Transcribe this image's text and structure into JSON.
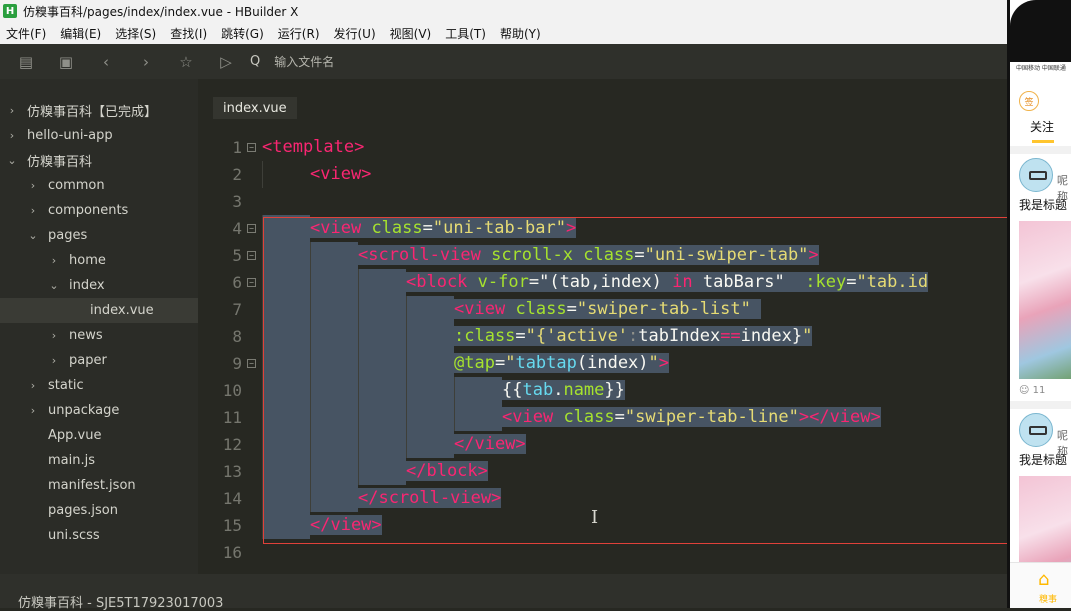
{
  "window": {
    "app_icon": "H",
    "title": "仿糗事百科/pages/index/index.vue - HBuilder X"
  },
  "menu": [
    "文件(F)",
    "编辑(E)",
    "选择(S)",
    "查找(I)",
    "跳转(G)",
    "运行(R)",
    "发行(U)",
    "视图(V)",
    "工具(T)",
    "帮助(Y)"
  ],
  "toolbar": {
    "icons": [
      "new-file-icon",
      "save-icon",
      "back-icon",
      "forward-icon",
      "star-icon",
      "run-icon"
    ],
    "search_prefix": "Q",
    "search_placeholder": "输入文件名"
  },
  "sidebar": {
    "items": [
      {
        "label": "仿糗事百科【已完成】",
        "arrow": "›",
        "depth": 0
      },
      {
        "label": "hello-uni-app",
        "arrow": "›",
        "depth": 0
      },
      {
        "label": "仿糗事百科",
        "arrow": "⌄",
        "depth": 0
      },
      {
        "label": "common",
        "arrow": "›",
        "depth": 1
      },
      {
        "label": "components",
        "arrow": "›",
        "depth": 1
      },
      {
        "label": "pages",
        "arrow": "⌄",
        "depth": 1
      },
      {
        "label": "home",
        "arrow": "›",
        "depth": 2
      },
      {
        "label": "index",
        "arrow": "⌄",
        "depth": 2
      },
      {
        "label": "index.vue",
        "arrow": "",
        "depth": 3,
        "selected": true
      },
      {
        "label": "news",
        "arrow": "›",
        "depth": 2
      },
      {
        "label": "paper",
        "arrow": "›",
        "depth": 2
      },
      {
        "label": "static",
        "arrow": "›",
        "depth": 1
      },
      {
        "label": "unpackage",
        "arrow": "›",
        "depth": 1
      },
      {
        "label": "App.vue",
        "arrow": "",
        "depth": 1
      },
      {
        "label": "main.js",
        "arrow": "",
        "depth": 1
      },
      {
        "label": "manifest.json",
        "arrow": "",
        "depth": 1
      },
      {
        "label": "pages.json",
        "arrow": "",
        "depth": 1
      },
      {
        "label": "uni.scss",
        "arrow": "",
        "depth": 1
      }
    ]
  },
  "editor": {
    "tab": "index.vue",
    "lines": [
      {
        "n": "1",
        "fold": true,
        "indent": 0,
        "hl": false,
        "parts": [
          [
            "tag",
            "<template>"
          ]
        ]
      },
      {
        "n": "2",
        "fold": false,
        "indent": 1,
        "hl": false,
        "parts": [
          [
            "tag",
            "<view>"
          ]
        ]
      },
      {
        "n": "3",
        "fold": false,
        "indent": 0,
        "hl": false,
        "parts": []
      },
      {
        "n": "4",
        "fold": true,
        "indent": 1,
        "hl": true,
        "parts": [
          [
            "tag",
            "<view"
          ],
          [
            "plain",
            " "
          ],
          [
            "attr",
            "class"
          ],
          [
            "plain",
            "="
          ],
          [
            "str",
            "\"uni-tab-bar\""
          ],
          [
            "tag",
            ">"
          ]
        ]
      },
      {
        "n": "5",
        "fold": true,
        "indent": 2,
        "hl": true,
        "parts": [
          [
            "tag",
            "<scroll-view"
          ],
          [
            "plain",
            " "
          ],
          [
            "attr",
            "scroll-x"
          ],
          [
            "plain",
            " "
          ],
          [
            "attr",
            "class"
          ],
          [
            "plain",
            "="
          ],
          [
            "str",
            "\"uni-swiper-tab\""
          ],
          [
            "tag",
            ">"
          ]
        ]
      },
      {
        "n": "6",
        "fold": true,
        "indent": 3,
        "hl": true,
        "parts": [
          [
            "tag",
            "<block"
          ],
          [
            "plain",
            " "
          ],
          [
            "attr",
            "v-for"
          ],
          [
            "plain",
            "=\"(tab,index) "
          ],
          [
            "kw",
            "in"
          ],
          [
            "plain",
            " tabBars\"  "
          ],
          [
            "attr",
            ":key"
          ],
          [
            "plain",
            "="
          ],
          [
            "str",
            "\"tab.id"
          ]
        ]
      },
      {
        "n": "7",
        "fold": false,
        "indent": 4,
        "hl": true,
        "parts": [
          [
            "tag",
            "<view"
          ],
          [
            "plain",
            " "
          ],
          [
            "attr",
            "class"
          ],
          [
            "plain",
            "="
          ],
          [
            "str",
            "\"swiper-tab-list\""
          ],
          [
            "dim",
            " "
          ]
        ]
      },
      {
        "n": "8",
        "fold": false,
        "indent": 4,
        "hl": true,
        "parts": [
          [
            "attr",
            ":class"
          ],
          [
            "plain",
            "="
          ],
          [
            "str",
            "\"{"
          ],
          [
            "str",
            "'active'"
          ],
          [
            "dim",
            ":"
          ],
          [
            "plain",
            "tabIndex"
          ],
          [
            "kw",
            "=="
          ],
          [
            "plain",
            "index}"
          ],
          [
            "str",
            "\""
          ]
        ]
      },
      {
        "n": "9",
        "fold": true,
        "indent": 4,
        "hl": true,
        "parts": [
          [
            "attr",
            "@tap"
          ],
          [
            "plain",
            "="
          ],
          [
            "str",
            "\""
          ],
          [
            "fn",
            "tabtap"
          ],
          [
            "plain",
            "(index)"
          ],
          [
            "str",
            "\""
          ],
          [
            "tag",
            ">"
          ]
        ]
      },
      {
        "n": "10",
        "fold": false,
        "indent": 5,
        "hl": true,
        "parts": [
          [
            "plain",
            "{{"
          ],
          [
            "fn",
            "tab"
          ],
          [
            "plain",
            "."
          ],
          [
            "attr",
            "name"
          ],
          [
            "plain",
            "}}"
          ]
        ]
      },
      {
        "n": "11",
        "fold": false,
        "indent": 5,
        "hl": true,
        "parts": [
          [
            "tag",
            "<view"
          ],
          [
            "plain",
            " "
          ],
          [
            "attr",
            "class"
          ],
          [
            "plain",
            "="
          ],
          [
            "str",
            "\"swiper-tab-line\""
          ],
          [
            "tag",
            "></view>"
          ]
        ]
      },
      {
        "n": "12",
        "fold": false,
        "indent": 4,
        "hl": true,
        "parts": [
          [
            "tag",
            "</view>"
          ]
        ]
      },
      {
        "n": "13",
        "fold": false,
        "indent": 3,
        "hl": true,
        "parts": [
          [
            "tag",
            "</block>"
          ]
        ]
      },
      {
        "n": "14",
        "fold": false,
        "indent": 2,
        "hl": true,
        "parts": [
          [
            "tag",
            "</scroll-view>"
          ]
        ]
      },
      {
        "n": "15",
        "fold": false,
        "indent": 1,
        "hl": true,
        "parts": [
          [
            "tag",
            "</view>"
          ]
        ]
      },
      {
        "n": "16",
        "fold": false,
        "indent": 0,
        "hl": false,
        "parts": []
      }
    ]
  },
  "status": {
    "project": "仿糗事百科 - SJE5T17923017003"
  },
  "phone": {
    "status_text": "中国移动 中国联通",
    "sign_label": "签",
    "tab_label": "关注",
    "posts": [
      {
        "user": "呢称",
        "title": "我是标题",
        "reactions": "11"
      },
      {
        "user": "呢称",
        "title": "我是标题",
        "reactions": ""
      }
    ],
    "home_label": "糗事",
    "accent": "#ffc52e"
  }
}
